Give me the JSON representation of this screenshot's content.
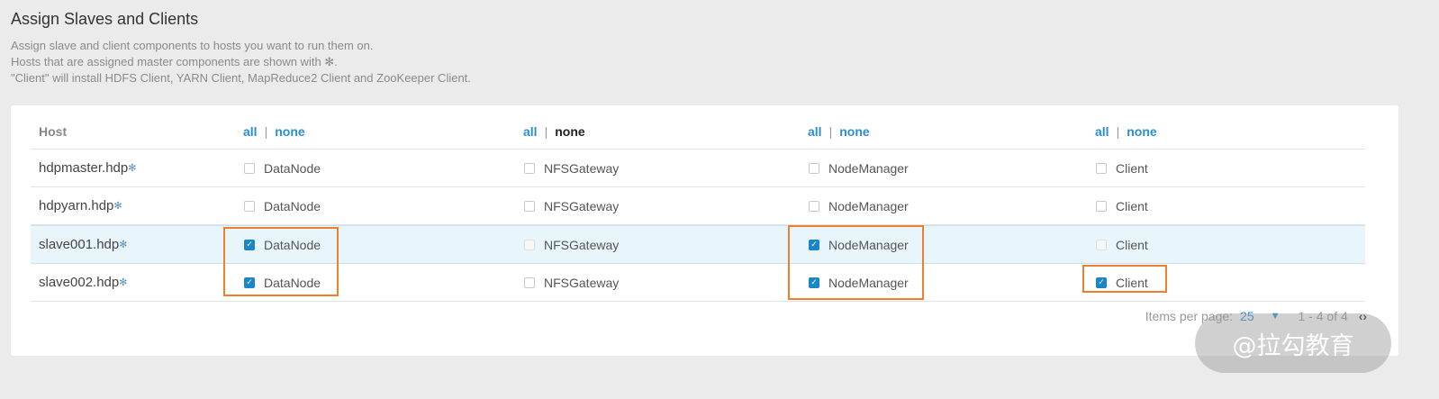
{
  "page": {
    "title": "Assign Slaves and Clients",
    "description": [
      "Assign slave and client components to hosts you want to run them on.",
      "Hosts that are assigned master components are shown with ✻.",
      "\"Client\" will install HDFS Client, YARN Client, MapReduce2 Client and ZooKeeper Client."
    ]
  },
  "table": {
    "host_header": "Host",
    "column_selectors": [
      {
        "all": "all",
        "separator": "|",
        "none": "none"
      },
      {
        "all": "all",
        "separator": "|",
        "none": "none"
      },
      {
        "all": "all",
        "separator": "|",
        "none": "none"
      },
      {
        "all": "all",
        "separator": "|",
        "none": "none"
      }
    ],
    "master_icon": "✻",
    "rows": [
      {
        "host": "hdpmaster.hdp",
        "components": [
          {
            "label": "DataNode",
            "checked": false
          },
          {
            "label": "NFSGateway",
            "checked": false
          },
          {
            "label": "NodeManager",
            "checked": false
          },
          {
            "label": "Client",
            "checked": false
          }
        ]
      },
      {
        "host": "hdpyarn.hdp",
        "components": [
          {
            "label": "DataNode",
            "checked": false
          },
          {
            "label": "NFSGateway",
            "checked": false
          },
          {
            "label": "NodeManager",
            "checked": false
          },
          {
            "label": "Client",
            "checked": false
          }
        ]
      },
      {
        "host": "slave001.hdp",
        "components": [
          {
            "label": "DataNode",
            "checked": true
          },
          {
            "label": "NFSGateway",
            "checked": false
          },
          {
            "label": "NodeManager",
            "checked": true
          },
          {
            "label": "Client",
            "checked": false
          }
        ]
      },
      {
        "host": "slave002.hdp",
        "components": [
          {
            "label": "DataNode",
            "checked": true
          },
          {
            "label": "NFSGateway",
            "checked": false
          },
          {
            "label": "NodeManager",
            "checked": true
          },
          {
            "label": "Client",
            "checked": true
          }
        ]
      }
    ]
  },
  "pager": {
    "items_per_page_label": "Items per page:",
    "items_per_page_value": "25",
    "dropdown_icon": "▼",
    "range": "1 - 4 of 4",
    "prev_icon": "‹",
    "next_icon": "›"
  },
  "watermark": "@拉勾教育",
  "colors": {
    "link": "#2b8ed0",
    "checkbox_checked": "#1b86c6",
    "highlight": "#ef7f2e",
    "row_active": "#e8f5fb"
  }
}
